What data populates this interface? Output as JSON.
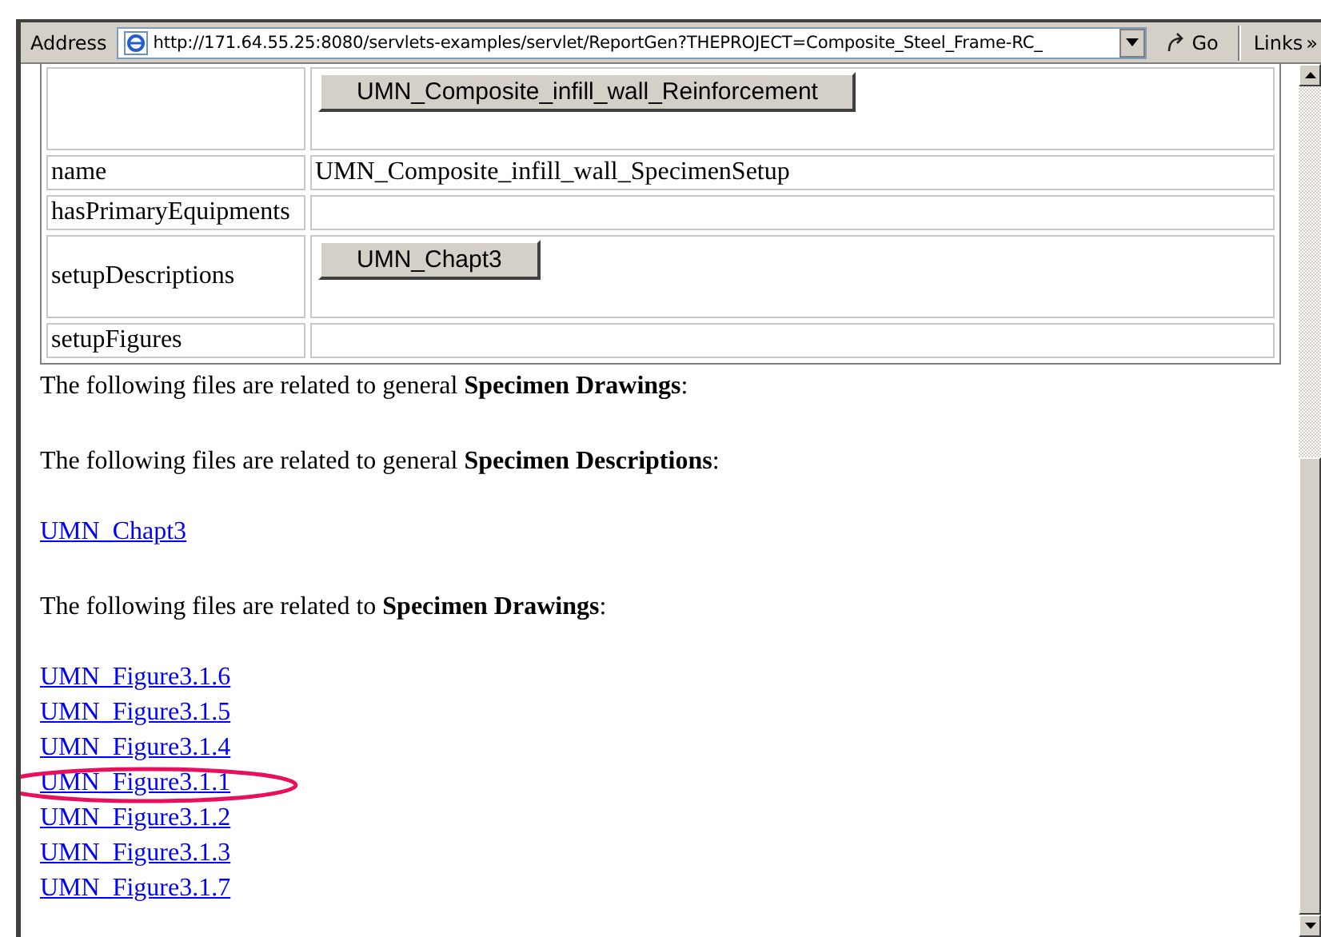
{
  "address_bar": {
    "label": "Address",
    "url": "http://171.64.55.25:8080/servlets-examples/servlet/ReportGen?THEPROJECT=Composite_Steel_Frame-RC_",
    "go": "Go",
    "links": "Links",
    "more": "»"
  },
  "table": {
    "rows": [
      {
        "buttons": [
          "UMN_Composite_infill_wall_Reinforcement"
        ]
      },
      {
        "label": "name",
        "value": "UMN_Composite_infill_wall_SpecimenSetup"
      },
      {
        "label": "hasPrimaryEquipments"
      },
      {
        "label": "setupDescriptions",
        "buttons": [
          "UMN_Chapt3"
        ]
      },
      {
        "label": "setupFigures"
      }
    ]
  },
  "sections": [
    {
      "text": "The following files are related to general **Specimen Drawings**:"
    },
    {
      "text": "The following files are related to general **Specimen Descriptions**:",
      "links": [
        {
          "text": "UMN_Chapt3",
          "highlighted": false
        }
      ]
    },
    {
      "text": "The following files are related to **Specimen Drawings**:",
      "links": [
        {
          "text": "UMN_Figure3.1.6",
          "highlighted": false
        },
        {
          "text": "UMN_Figure3.1.5",
          "highlighted": false
        },
        {
          "text": "UMN_Figure3.1.4",
          "highlighted": false
        },
        {
          "text": "UMN_Figure3.1.1",
          "highlighted": true
        },
        {
          "text": "UMN_Figure3.1.2",
          "highlighted": false
        },
        {
          "text": "UMN_Figure3.1.3",
          "highlighted": false
        },
        {
          "text": "UMN_Figure3.1.7",
          "highlighted": false
        }
      ]
    }
  ]
}
